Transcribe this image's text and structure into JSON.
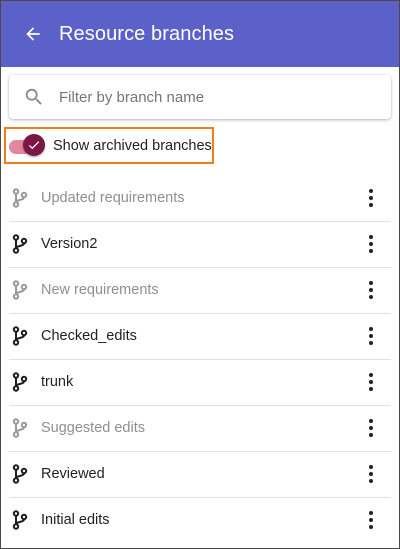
{
  "header": {
    "title": "Resource branches",
    "back_icon": "arrow-back-icon",
    "color": "#5c61c9"
  },
  "search": {
    "placeholder": "Filter by branch name",
    "value": "",
    "icon": "search-icon"
  },
  "archive_toggle": {
    "label": "Show archived branches",
    "checked": true,
    "highlight_color": "#ee7d1a"
  },
  "branches": [
    {
      "name": "Updated requirements",
      "archived": true
    },
    {
      "name": "Version2",
      "archived": false
    },
    {
      "name": "New requirements",
      "archived": true
    },
    {
      "name": "Checked_edits",
      "archived": false
    },
    {
      "name": "trunk",
      "archived": false
    },
    {
      "name": "Suggested edits",
      "archived": true
    },
    {
      "name": "Reviewed",
      "archived": false
    },
    {
      "name": "Initial edits",
      "archived": false
    }
  ],
  "icons": {
    "branch": "branch-icon",
    "more": "more-vertical-icon"
  }
}
